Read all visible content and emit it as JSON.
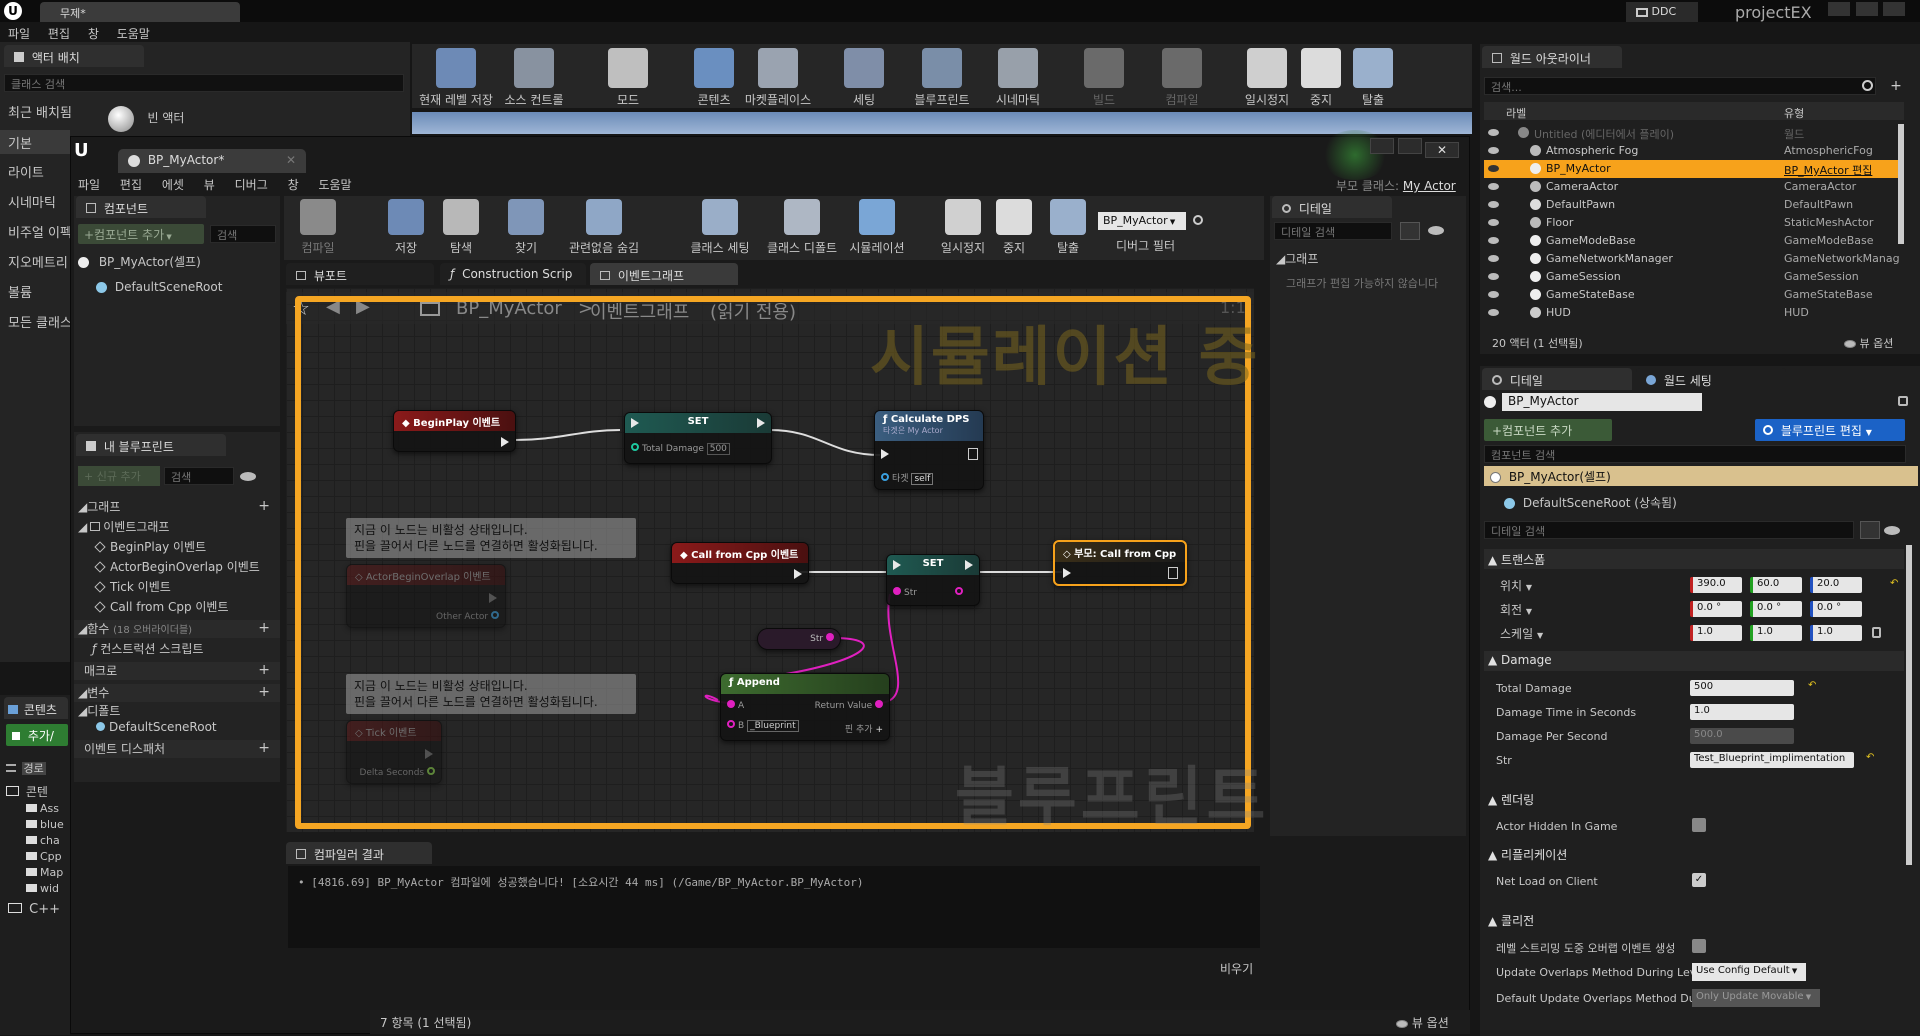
{
  "main_window": {
    "tab_title": "무제*",
    "menu": [
      "파일",
      "편집",
      "창",
      "도움말"
    ],
    "ddc_label": "DDC",
    "project_name": "projectEX"
  },
  "modes_panel": {
    "tab_title": "액터 배치",
    "search_placeholder": "클래스 검색",
    "categories": [
      "최근 배치됨",
      "기본",
      "라이트",
      "시네마틱",
      "비주얼 이펙",
      "지오메트리",
      "볼륨",
      "모든 클래스"
    ],
    "empty_actor": "빈 액터"
  },
  "level_toolbar": [
    {
      "label": "현재 레벨 저장",
      "icon": "save-icon"
    },
    {
      "label": "소스 컨트롤",
      "icon": "source-control-icon"
    },
    {
      "label": "모드",
      "icon": "modes-icon"
    },
    {
      "label": "콘텐츠",
      "icon": "content-icon"
    },
    {
      "label": "마켓플레이스",
      "icon": "marketplace-icon"
    },
    {
      "label": "세팅",
      "icon": "settings-icon"
    },
    {
      "label": "블루프린트",
      "icon": "blueprint-icon"
    },
    {
      "label": "시네마틱",
      "icon": "cinematics-icon"
    },
    {
      "label": "빌드",
      "icon": "build-icon"
    },
    {
      "label": "컴파일",
      "icon": "compile-icon"
    },
    {
      "label": "일시정지",
      "icon": "pause-icon"
    },
    {
      "label": "중지",
      "icon": "stop-icon"
    },
    {
      "label": "탈출",
      "icon": "eject-icon"
    }
  ],
  "content_browser": {
    "tab": "콘텐츠",
    "add_button": "추가/",
    "filter_tab": "경로",
    "root": "콘텐",
    "folders": [
      "Ass",
      "blue",
      "cha",
      "Cpp",
      "Map",
      "wid"
    ],
    "cpp": "C++"
  },
  "bp_editor": {
    "tab_title": "BP_MyActor*",
    "menu": [
      "파일",
      "편집",
      "에셋",
      "뷰",
      "디버그",
      "창",
      "도움말"
    ],
    "parent_class_label": "부모 클래스:",
    "parent_class_value": "My Actor",
    "toolbar": [
      {
        "label": "컴파일",
        "icon": "compile-icon"
      },
      {
        "label": "저장",
        "icon": "save-icon"
      },
      {
        "label": "탐색",
        "icon": "browse-icon"
      },
      {
        "label": "찾기",
        "icon": "find-icon"
      },
      {
        "label": "관련없음 숨김",
        "icon": "hide-unrelated-icon"
      },
      {
        "label": "클래스 세팅",
        "icon": "class-settings-icon"
      },
      {
        "label": "클래스 디폴트",
        "icon": "class-defaults-icon"
      },
      {
        "label": "시뮬레이션",
        "icon": "simulation-icon"
      },
      {
        "label": "일시정지",
        "icon": "pause-icon"
      },
      {
        "label": "중지",
        "icon": "stop-icon"
      },
      {
        "label": "탈출",
        "icon": "eject-icon"
      }
    ],
    "debug_object": "BP_MyActor",
    "debug_filter_label": "디버그 필터",
    "components": {
      "tab": "컴포넌트",
      "add_button": "+컴포넌트 추가",
      "search_placeholder": "검색",
      "items": [
        "BP_MyActor(셀프)",
        "DefaultSceneRoot"
      ]
    },
    "my_blueprint": {
      "tab": "내 블루프린트",
      "add_new": "+ 신규 추가",
      "search_placeholder": "검색",
      "graphs_header": "그래프",
      "event_graph": "이벤트그래프",
      "events": [
        "BeginPlay 이벤트",
        "ActorBeginOverlap 이벤트",
        "Tick 이벤트",
        "Call from Cpp 이벤트"
      ],
      "functions_header": "함수",
      "functions_note": "(18 오버라이더블)",
      "construction_script": "컨스트럭션 스크립트",
      "macros_header": "매크로",
      "variables_header": "변수",
      "components_header": "디폴트",
      "default_scene_root": "DefaultSceneRoot",
      "dispatchers_header": "이벤트 디스패처"
    },
    "doc_tabs": [
      "뷰포트",
      "Construction Scrip",
      "이벤트그래프"
    ],
    "graph": {
      "breadcrumb_bp": "BP_MyActor",
      "breadcrumb_sep": ">",
      "breadcrumb_graph": "이벤트그래프",
      "readonly": "(읽기 전용)",
      "zoom": "1:1",
      "simulating_watermark": "시뮬레이션 중",
      "blueprint_watermark": "블루프린트",
      "nodes": {
        "beginplay": "BeginPlay 이벤트",
        "set1_title": "SET",
        "set1_pin": "Total Damage",
        "set1_value": "500",
        "calc_title": "Calculate DPS",
        "calc_sub": "타겟은 My Actor",
        "calc_target": "타겟",
        "calc_self": "self",
        "comment1": "지금 이 노드는 비활성 상태입니다.\n핀을 끌어서 다른 노드를 연결하면 활성화됩니다.",
        "overlap_title": "ActorBeginOverlap 이벤트",
        "overlap_pin": "Other Actor",
        "callcpp": "Call from Cpp 이벤트",
        "set2_title": "SET",
        "set2_pin": "Str",
        "parent_call": "부모: Call from Cpp",
        "str_getter": "Str",
        "append_title": "Append",
        "append_a": "A",
        "append_b": "B",
        "append_b_value": "_Blueprint",
        "append_return": "Return Value",
        "append_addpin": "핀 추가",
        "comment2": "지금 이 노드는 비활성 상태입니다.\n핀을 끌어서 다른 노드를 연결하면 활성화됩니다.",
        "tick_title": "Tick 이벤트",
        "tick_pin": "Delta Seconds"
      }
    },
    "compiler": {
      "tab": "컴파일러 결과",
      "log": "[4816.69] BP_MyActor 컴파일에 성공했습니다! [소요시간 44 ms] (/Game/BP_MyActor.BP_MyActor)",
      "clear": "비우기"
    },
    "details": {
      "tab": "디테일",
      "search_placeholder": "디테일 검색",
      "graph_header": "그래프",
      "graph_note": "그래프가 편집 가능하지 않습니다"
    }
  },
  "status_bar": {
    "items": "7 항목 (1 선택됨)",
    "view_options": "뷰 옵션"
  },
  "world_outliner": {
    "tab": "월드 아웃라이너",
    "search_placeholder": "검색...",
    "col_label": "라벨",
    "col_type": "유형",
    "rows": [
      {
        "label": "Untitled (에디터에서 플레이)",
        "type": "월드",
        "icon": "world-icon"
      },
      {
        "label": "Atmospheric Fog",
        "type": "AtmosphericFog",
        "icon": "fog-icon"
      },
      {
        "label": "BP_MyActor",
        "type": "BP_MyActor 편집",
        "icon": "actor-icon"
      },
      {
        "label": "CameraActor",
        "type": "CameraActor",
        "icon": "camera-icon"
      },
      {
        "label": "DefaultPawn",
        "type": "DefaultPawn",
        "icon": "pawn-icon"
      },
      {
        "label": "Floor",
        "type": "StaticMeshActor",
        "icon": "mesh-icon"
      },
      {
        "label": "GameModeBase",
        "type": "GameModeBase",
        "icon": "actor-icon"
      },
      {
        "label": "GameNetworkManager",
        "type": "GameNetworkManag",
        "icon": "actor-icon"
      },
      {
        "label": "GameSession",
        "type": "GameSession",
        "icon": "actor-icon"
      },
      {
        "label": "GameStateBase",
        "type": "GameStateBase",
        "icon": "actor-icon"
      },
      {
        "label": "HUD",
        "type": "HUD",
        "icon": "hud-icon"
      }
    ],
    "count": "20 액터 (1 선택됨)",
    "view_options": "뷰 옵션"
  },
  "details_panel": {
    "tab": "디테일",
    "world_settings_tab": "월드 세팅",
    "actor_name": "BP_MyActor",
    "add_component": "+컴포넌트 추가",
    "edit_blueprint": "블루프린트 편집",
    "component_search": "컴포넌트 검색",
    "components": [
      "BP_MyActor(셀프)",
      "DefaultSceneRoot (상속됨)"
    ],
    "detail_search": "디테일 검색",
    "transform": {
      "header": "트랜스폼",
      "location_label": "위치",
      "location": [
        "390.0",
        "60.0",
        "20.0"
      ],
      "rotation_label": "회전",
      "rotation": [
        "0.0 °",
        "0.0 °",
        "0.0 °"
      ],
      "scale_label": "스케일",
      "scale": [
        "1.0",
        "1.0",
        "1.0"
      ]
    },
    "damage": {
      "header": "Damage",
      "total_damage_label": "Total Damage",
      "total_damage": "500",
      "damage_time_label": "Damage Time in Seconds",
      "damage_time": "1.0",
      "dps_label": "Damage Per Second",
      "dps": "500.0",
      "str_label": "Str",
      "str": "Test_Blueprint_implimentation"
    },
    "rendering": {
      "header": "렌더링",
      "hidden_label": "Actor Hidden In Game",
      "hidden": false
    },
    "replication": {
      "header": "리플리케이션",
      "net_load_label": "Net Load on Client",
      "net_load": true
    },
    "collision": {
      "header": "콜리전",
      "stream_label": "레벨 스트리밍 도중 오버랩 이벤트 생성",
      "stream": false,
      "update_label": "Update Overlaps Method During Level",
      "update_value": "Use Config Default",
      "default_label": "Default Update Overlaps Method Durin",
      "default_value": "Only Update Movable"
    }
  },
  "colors": {
    "accent_orange": "#f5a623",
    "selection": "#f7a21b",
    "event_red": "#8b1a1a",
    "set_teal": "#1f5a52",
    "function_blue": "#3b5e80",
    "append_green": "#3d6b2f",
    "string_pink": "#e020c0",
    "edit_blue": "#1b62c6"
  }
}
